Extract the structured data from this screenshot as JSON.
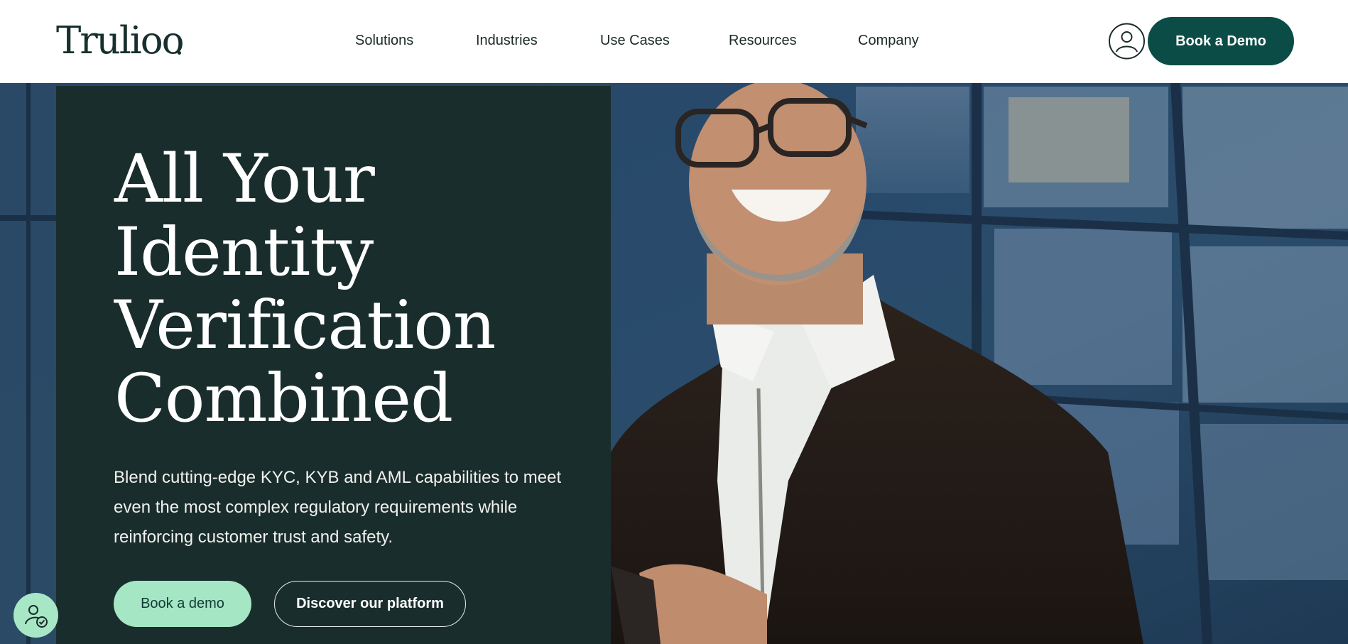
{
  "header": {
    "logo": "Trulioo",
    "nav": [
      "Solutions",
      "Industries",
      "Use Cases",
      "Resources",
      "Company"
    ],
    "account_icon": "user-icon",
    "cta_label": "Book a Demo"
  },
  "hero": {
    "title_lines": [
      "All Your",
      "Identity",
      "Verification",
      "Combined"
    ],
    "subtitle": "Blend cutting-edge KYC, KYB and AML capabilities to meet even the most complex regulatory requirements while reinforcing customer trust and safety.",
    "primary_label": "Book a demo",
    "secondary_label": "Discover our platform"
  },
  "accessibility": {
    "icon": "accessibility-user-check-icon"
  },
  "colors": {
    "brand_dark": "#0b4d46",
    "panel": "#1a2d2d",
    "mint": "#a5e6c4",
    "text_dark": "#1b2a28"
  }
}
